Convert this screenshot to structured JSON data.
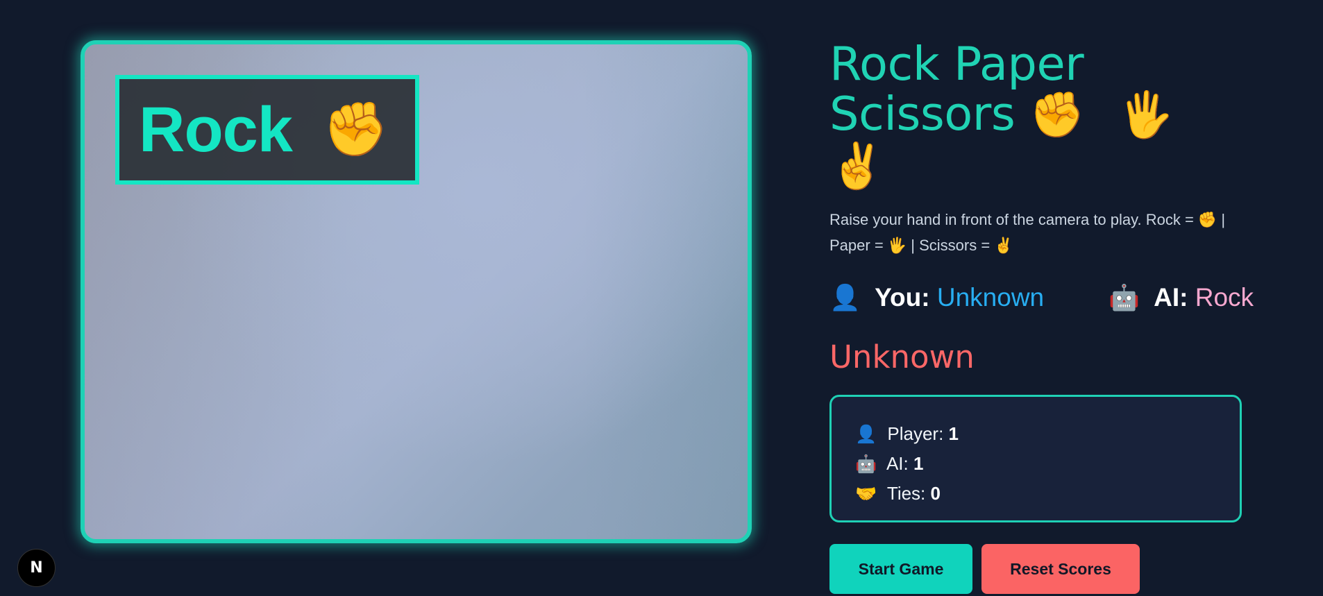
{
  "camera": {
    "detected_label": "Rock",
    "detected_emoji": "✊"
  },
  "header": {
    "title_line1": "Rock Paper",
    "title_line2": "Scissors",
    "title_emojis": "✊ 🖐 ✌️"
  },
  "instructions": "Raise your hand in front of the camera to play. Rock = ✊ | Paper = 🖐 | Scissors = ✌️",
  "moves": {
    "you_icon": "👤",
    "you_label": "You:",
    "you_value": "Unknown",
    "ai_icon": "🤖",
    "ai_label": "AI:",
    "ai_value": "Rock"
  },
  "result": "Unknown",
  "scores": {
    "player_icon": "👤",
    "player_label": "Player:",
    "player_value": "1",
    "ai_icon": "🤖",
    "ai_label": "AI:",
    "ai_value": "1",
    "ties_icon": "🤝",
    "ties_label": "Ties:",
    "ties_value": "0"
  },
  "buttons": {
    "start": "Start Game",
    "reset": "Reset Scores"
  },
  "badge": {
    "letter": "N"
  },
  "colors": {
    "accent": "#1fd1b5",
    "danger": "#fb6464",
    "you_value": "#28aef2",
    "ai_value": "#f7a8cf",
    "background": "#111a2c"
  }
}
